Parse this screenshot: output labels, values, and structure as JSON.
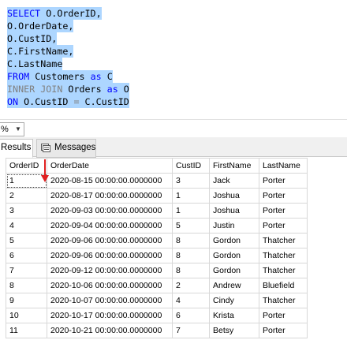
{
  "editor": {
    "lines": [
      {
        "parts": [
          {
            "t": "SELECT ",
            "c": "kw"
          },
          {
            "t": "O.OrderID,",
            "c": "tx"
          }
        ]
      },
      {
        "parts": [
          {
            "t": "O.OrderDate,",
            "c": "tx"
          }
        ]
      },
      {
        "parts": [
          {
            "t": "O.CustID,",
            "c": "tx"
          }
        ]
      },
      {
        "parts": [
          {
            "t": "C.FirstName,",
            "c": "tx"
          }
        ]
      },
      {
        "parts": [
          {
            "t": "C.LastName",
            "c": "tx"
          }
        ]
      },
      {
        "parts": [
          {
            "t": "FROM ",
            "c": "kw"
          },
          {
            "t": "Customers ",
            "c": "tx"
          },
          {
            "t": "as ",
            "c": "kw"
          },
          {
            "t": "C",
            "c": "tx"
          }
        ]
      },
      {
        "parts": [
          {
            "t": "INNER JOIN ",
            "c": "gr"
          },
          {
            "t": "Orders ",
            "c": "tx"
          },
          {
            "t": "as ",
            "c": "kw"
          },
          {
            "t": "O",
            "c": "tx"
          }
        ]
      },
      {
        "parts": [
          {
            "t": "ON ",
            "c": "kw"
          },
          {
            "t": "O.CustID ",
            "c": "tx"
          },
          {
            "t": "= ",
            "c": "gr"
          },
          {
            "t": "C.CustID",
            "c": "tx"
          }
        ]
      }
    ],
    "selection_color": "#add6ff"
  },
  "zoom": {
    "value": "%",
    "arrow_icon": "chevron-down-icon"
  },
  "tabs": {
    "results": "Results",
    "messages": "Messages",
    "messages_icon": "messages-icon"
  },
  "grid": {
    "columns": [
      "OrderID",
      "OrderDate",
      "CustID",
      "FirstName",
      "LastName"
    ],
    "rows": [
      [
        "1",
        "2020-08-15 00:00:00.0000000",
        "3",
        "Jack",
        "Porter"
      ],
      [
        "2",
        "2020-08-17 00:00:00.0000000",
        "1",
        "Joshua",
        "Porter"
      ],
      [
        "3",
        "2020-09-03 00:00:00.0000000",
        "1",
        "Joshua",
        "Porter"
      ],
      [
        "4",
        "2020-09-04 00:00:00.0000000",
        "5",
        "Justin",
        "Porter"
      ],
      [
        "5",
        "2020-09-06 00:00:00.0000000",
        "8",
        "Gordon",
        "Thatcher"
      ],
      [
        "6",
        "2020-09-06 00:00:00.0000000",
        "8",
        "Gordon",
        "Thatcher"
      ],
      [
        "7",
        "2020-09-12 00:00:00.0000000",
        "8",
        "Gordon",
        "Thatcher"
      ],
      [
        "8",
        "2020-10-06 00:00:00.0000000",
        "2",
        "Andrew",
        "Bluefield"
      ],
      [
        "9",
        "2020-10-07 00:00:00.0000000",
        "4",
        "Cindy",
        "Thatcher"
      ],
      [
        "10",
        "2020-10-17 00:00:00.0000000",
        "6",
        "Krista",
        "Porter"
      ],
      [
        "11",
        "2020-10-21 00:00:00.0000000",
        "7",
        "Betsy",
        "Porter"
      ]
    ]
  },
  "annotation": {
    "arrow_color": "#e02020"
  }
}
